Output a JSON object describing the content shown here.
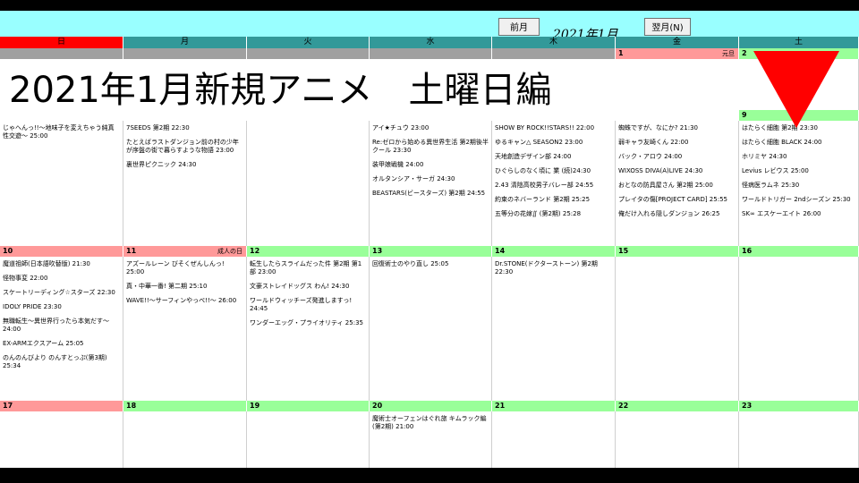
{
  "toolbar": {
    "prev_label": "前月(L)",
    "next_label": "翌月(N)",
    "month_label": "2021年1月"
  },
  "weekdays": [
    "日",
    "月",
    "火",
    "水",
    "木",
    "金",
    "土"
  ],
  "title": "2021年1月新規アニメ　土曜日編",
  "colors": {
    "sunday_header": "#FF0000",
    "weekday_header": "#339999",
    "sunday_date": "#FF9999",
    "weekday_date": "#99FF99",
    "holiday_date": "#FF9999",
    "blank_date": "#A0A0A0",
    "toolbar": "#99FFFF",
    "arrow": "#FF0000"
  },
  "arrow_icon": "red-down-triangle",
  "weeks": [
    {
      "days": [
        {
          "num": "",
          "holiday": "",
          "events": []
        },
        {
          "num": "",
          "holiday": "",
          "events": []
        },
        {
          "num": "",
          "holiday": "",
          "events": []
        },
        {
          "num": "",
          "holiday": "",
          "events": []
        },
        {
          "num": "",
          "holiday": "",
          "events": []
        },
        {
          "num": "1",
          "holiday": "元旦",
          "events": []
        },
        {
          "num": "2",
          "holiday": "",
          "events": []
        }
      ]
    },
    {
      "days": [
        {
          "num": "3",
          "holiday": "",
          "events": [
            "じゃへんっ!!～地味子を変えちゃう純真性交遊～ 25:00"
          ]
        },
        {
          "num": "4",
          "holiday": "",
          "events": [
            "7SEEDS 第2期 22:30",
            "たとえばラストダンジョン前の村の少年が序盤の街で暮らすような物語 23:00",
            "裏世界ピクニック 24:30"
          ]
        },
        {
          "num": "5",
          "holiday": "",
          "events": []
        },
        {
          "num": "6",
          "holiday": "",
          "events": [
            "アイ★チュウ 23:00",
            "Re:ゼロから始める異世界生活 第2期後半クール 23:30",
            "装甲娘戦機 24:00",
            "オルタンシア・サーガ 24:30",
            "BEASTARS(ビースターズ) 第2期 24:55"
          ]
        },
        {
          "num": "7",
          "holiday": "",
          "events": [
            "SHOW BY ROCK!!STARS!! 22:00",
            "ゆるキャン△ SEASON2 23:00",
            "天地創造デザイン部 24:00",
            "ひぐらしのなく頃に 業 (続)24:30",
            "2.43 清陰高校男子バレー部 24:55",
            "約束のネバーランド 第2期 25:25",
            "五等分の花嫁∬ (第2期) 25:28"
          ]
        },
        {
          "num": "8",
          "holiday": "",
          "events": [
            "蜘蛛ですが、なにか? 21:30",
            "弱キャラ友崎くん 22:00",
            "バック・アロウ 24:00",
            "WIXOSS DIVA(A)LIVE 24:30",
            "おとなの防具屋さん 第2期 25:00",
            "プレイタの傷[PROJECT CARD] 25:55",
            "俺だけ入れる隠しダンジョン 26:25"
          ]
        },
        {
          "num": "9",
          "holiday": "",
          "events": [
            "はたらく細胞 第2期 23:30",
            "はたらく細胞 BLACK 24:00",
            "ホリミヤ 24:30",
            "Levius レビウス 25:00",
            "怪病医ラムネ 25:30",
            "ワールドトリガー 2ndシーズン 25:30",
            "SK∞ エスケーエイト 26:00"
          ]
        }
      ]
    },
    {
      "days": [
        {
          "num": "10",
          "holiday": "",
          "events": [
            "魔道祖師(日本語吹替版) 21:30",
            "怪物事変 22:00",
            "スケートリーディング☆スターズ 22:30",
            "IDOLY PRIDE 23:30",
            "無職転生～異世界行ったら本気だす～ 24:00",
            "EX-ARMエクスアーム 25:05",
            "のんのんびより のんすとっぷ(第3期) 25:34"
          ]
        },
        {
          "num": "11",
          "holiday": "成人の日",
          "events": [
            "アズールレーン びそくぜんしんっ! 25:00",
            "真・中華一番! 第二期 25:10",
            "WAVE!!～サーフィンやっぺ!!～ 26:00"
          ]
        },
        {
          "num": "12",
          "holiday": "",
          "events": [
            "転生したらスライムだった件 第2期 第1部 23:00",
            "文豪ストレイドッグス わん! 24:30",
            "ワールドウィッチーズ発進しますっ! 24:45",
            "ワンダーエッグ・プライオリティ 25:35"
          ]
        },
        {
          "num": "13",
          "holiday": "",
          "events": [
            "回復術士のやり直し 25:05"
          ]
        },
        {
          "num": "14",
          "holiday": "",
          "events": [
            "Dr.STONE(ドクターストーン) 第2期 22:30"
          ]
        },
        {
          "num": "15",
          "holiday": "",
          "events": []
        },
        {
          "num": "16",
          "holiday": "",
          "events": []
        }
      ]
    },
    {
      "days": [
        {
          "num": "17",
          "holiday": "",
          "events": []
        },
        {
          "num": "18",
          "holiday": "",
          "events": []
        },
        {
          "num": "19",
          "holiday": "",
          "events": []
        },
        {
          "num": "20",
          "holiday": "",
          "events": [
            "魔術士オーフェンはぐれ旅 キムラック編 (第2期) 21:00"
          ]
        },
        {
          "num": "21",
          "holiday": "",
          "events": []
        },
        {
          "num": "22",
          "holiday": "",
          "events": []
        },
        {
          "num": "23",
          "holiday": "",
          "events": []
        }
      ]
    }
  ]
}
